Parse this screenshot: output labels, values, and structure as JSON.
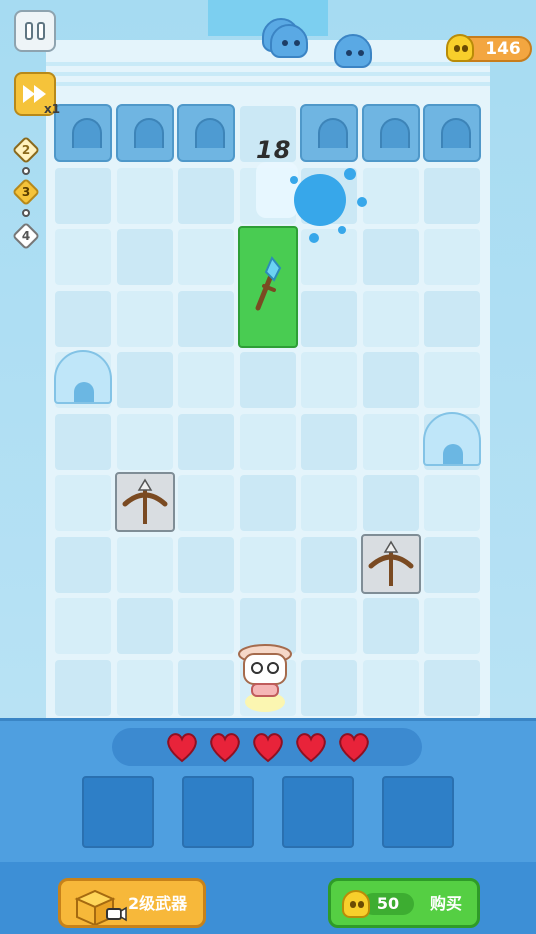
{
  "hud": {
    "coins": "146",
    "speed_multiplier": "x1",
    "waves": [
      {
        "label": "2",
        "state": "done"
      },
      {
        "label": "3",
        "state": "current"
      },
      {
        "label": "4",
        "state": "upcoming"
      }
    ],
    "damage_popup": "18"
  },
  "board": {
    "enemies": [
      "blue-slime",
      "blue-slime",
      "blue-slime"
    ],
    "weapon_card": "crystal-staff",
    "towers": [
      "crossbow",
      "crossbow"
    ],
    "obstacles": [
      "igloo",
      "igloo"
    ]
  },
  "player": {
    "hearts": 5,
    "inventory_slots": 4
  },
  "actions": {
    "level_weapon_label": "2级武器",
    "buy_price": "50",
    "buy_label": "购买"
  },
  "colors": {
    "accent_gold": "#f5c33a",
    "buy_green": "#55cf43",
    "panel_blue": "#4f9fe0",
    "heart_red": "#e8233a"
  }
}
